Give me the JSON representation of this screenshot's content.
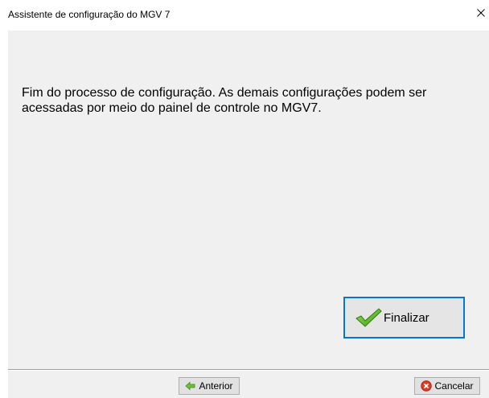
{
  "window": {
    "title": "Assistente de configuração do MGV 7"
  },
  "main": {
    "message": "Fim do processo de configuração. As demais configurações podem ser acessadas por meio do painel de controle no MGV7."
  },
  "buttons": {
    "finalize_label": "Finalizar",
    "previous_label": "Anterior",
    "cancel_label": "Cancelar"
  },
  "icons": {
    "close": "close-icon",
    "finalize": "checkmark-icon",
    "previous": "arrow-left-icon",
    "cancel": "cancel-icon"
  },
  "colors": {
    "focus_border": "#0078d7",
    "dialog_background": "#f0f0f0",
    "check_green": "#5cb82a",
    "cancel_red": "#e03b24"
  }
}
